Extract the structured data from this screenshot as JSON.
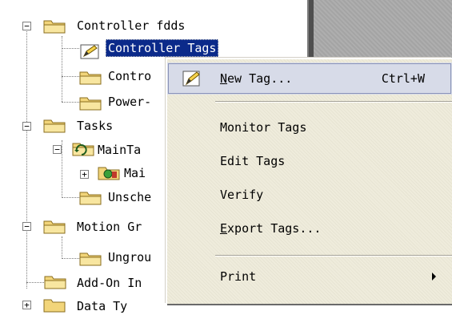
{
  "tree": {
    "nodes": [
      {
        "label": "Controller fdds",
        "expander": "−"
      },
      {
        "label": "Controller Tags"
      },
      {
        "label": "Contro"
      },
      {
        "label": "Power-"
      },
      {
        "label": "Tasks",
        "expander": "−"
      },
      {
        "label": "MainTa",
        "expander": "−"
      },
      {
        "label": "Mai",
        "expander": "+"
      },
      {
        "label": "Unsche"
      },
      {
        "label": "Motion Gr",
        "expander": "−"
      },
      {
        "label": "Ungrou"
      },
      {
        "label": "Add-On In"
      },
      {
        "label": "Data Ty",
        "expander": "+"
      }
    ]
  },
  "menu": {
    "new_tag": {
      "label": "New Tag...",
      "first": "N",
      "rest": "ew Tag...",
      "shortcut": "Ctrl+W"
    },
    "monitor_tags": "Monitor Tags",
    "edit_tags": "Edit Tags",
    "verify": "Verify",
    "export_tags": {
      "first": "E",
      "rest": "xport Tags..."
    },
    "print": "Print"
  },
  "colors": {
    "selection": "#0b2a8a",
    "menu_bg": "#ece9d8",
    "menu_highlight": "#d7dbe8",
    "folder": "#f2d57a"
  },
  "icons": [
    "folder-icon",
    "edit-tag-icon",
    "task-icon",
    "program-icon",
    "submenu-arrow-icon"
  ]
}
